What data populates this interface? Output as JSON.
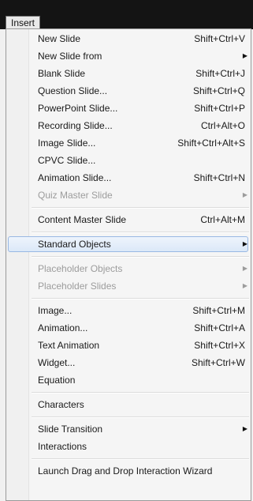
{
  "menubar": {
    "tab_label": "Insert"
  },
  "menu": {
    "entries": [
      {
        "type": "item",
        "name": "new-slide",
        "label": "New Slide",
        "shortcut": "Shift+Ctrl+V",
        "submenu": false,
        "disabled": false
      },
      {
        "type": "item",
        "name": "new-slide-from",
        "label": "New Slide from",
        "shortcut": "",
        "submenu": true,
        "disabled": false
      },
      {
        "type": "item",
        "name": "blank-slide",
        "label": "Blank Slide",
        "shortcut": "Shift+Ctrl+J",
        "submenu": false,
        "disabled": false
      },
      {
        "type": "item",
        "name": "question-slide",
        "label": "Question Slide...",
        "shortcut": "Shift+Ctrl+Q",
        "submenu": false,
        "disabled": false
      },
      {
        "type": "item",
        "name": "powerpoint-slide",
        "label": "PowerPoint Slide...",
        "shortcut": "Shift+Ctrl+P",
        "submenu": false,
        "disabled": false
      },
      {
        "type": "item",
        "name": "recording-slide",
        "label": "Recording Slide...",
        "shortcut": "Ctrl+Alt+O",
        "submenu": false,
        "disabled": false
      },
      {
        "type": "item",
        "name": "image-slide",
        "label": "Image Slide...",
        "shortcut": "Shift+Ctrl+Alt+S",
        "submenu": false,
        "disabled": false
      },
      {
        "type": "item",
        "name": "cpvc-slide",
        "label": "CPVC Slide...",
        "shortcut": "",
        "submenu": false,
        "disabled": false
      },
      {
        "type": "item",
        "name": "animation-slide",
        "label": "Animation Slide...",
        "shortcut": "Shift+Ctrl+N",
        "submenu": false,
        "disabled": false
      },
      {
        "type": "item",
        "name": "quiz-master-slide",
        "label": "Quiz Master Slide",
        "shortcut": "",
        "submenu": true,
        "disabled": true
      },
      {
        "type": "separator"
      },
      {
        "type": "item",
        "name": "content-master-slide",
        "label": "Content Master Slide",
        "shortcut": "Ctrl+Alt+M",
        "submenu": false,
        "disabled": false
      },
      {
        "type": "separator"
      },
      {
        "type": "item",
        "name": "standard-objects",
        "label": "Standard Objects",
        "shortcut": "",
        "submenu": true,
        "disabled": false,
        "selected": true
      },
      {
        "type": "separator"
      },
      {
        "type": "item",
        "name": "placeholder-objects",
        "label": "Placeholder Objects",
        "shortcut": "",
        "submenu": true,
        "disabled": true
      },
      {
        "type": "item",
        "name": "placeholder-slides",
        "label": "Placeholder Slides",
        "shortcut": "",
        "submenu": true,
        "disabled": true
      },
      {
        "type": "separator"
      },
      {
        "type": "item",
        "name": "image",
        "label": "Image...",
        "shortcut": "Shift+Ctrl+M",
        "submenu": false,
        "disabled": false
      },
      {
        "type": "item",
        "name": "animation",
        "label": "Animation...",
        "shortcut": "Shift+Ctrl+A",
        "submenu": false,
        "disabled": false
      },
      {
        "type": "item",
        "name": "text-animation",
        "label": "Text Animation",
        "shortcut": "Shift+Ctrl+X",
        "submenu": false,
        "disabled": false
      },
      {
        "type": "item",
        "name": "widget",
        "label": "Widget...",
        "shortcut": "Shift+Ctrl+W",
        "submenu": false,
        "disabled": false
      },
      {
        "type": "item",
        "name": "equation",
        "label": "Equation",
        "shortcut": "",
        "submenu": false,
        "disabled": false
      },
      {
        "type": "separator"
      },
      {
        "type": "item",
        "name": "characters",
        "label": "Characters",
        "shortcut": "",
        "submenu": false,
        "disabled": false
      },
      {
        "type": "separator"
      },
      {
        "type": "item",
        "name": "slide-transition",
        "label": "Slide Transition",
        "shortcut": "",
        "submenu": true,
        "disabled": false
      },
      {
        "type": "item",
        "name": "interactions",
        "label": "Interactions",
        "shortcut": "",
        "submenu": false,
        "disabled": false
      },
      {
        "type": "separator"
      },
      {
        "type": "item",
        "name": "launch-drag-and-drop-wizard",
        "label": "Launch Drag and Drop Interaction Wizard",
        "shortcut": "",
        "submenu": false,
        "disabled": false
      }
    ]
  },
  "icons": {
    "submenu_arrow": "submenu-arrow-icon",
    "submenu_arrow_glyph": "▶"
  },
  "colors": {
    "menubar_bg": "#141414",
    "selection_border": "#99b8e3",
    "disabled_text": "#9c9c9c"
  }
}
